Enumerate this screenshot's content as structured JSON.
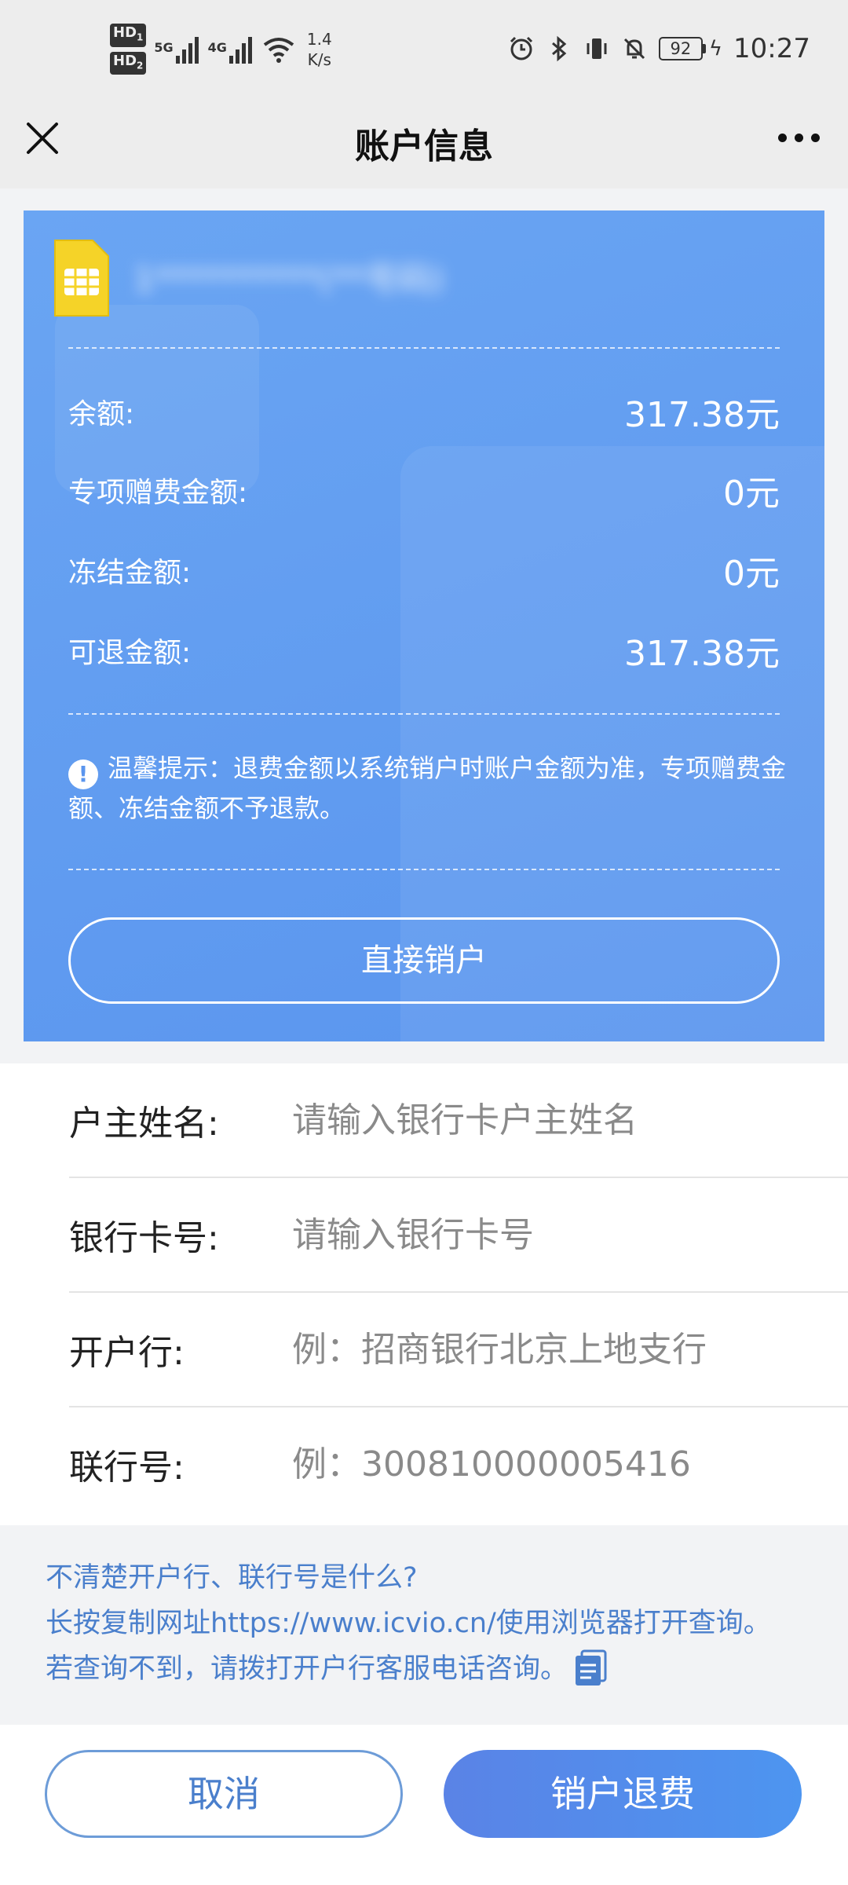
{
  "status_bar": {
    "hd1": "HD",
    "hd1_sub": "1",
    "hd2": "HD",
    "hd2_sub": "2",
    "sig1_label": "5G",
    "sig2_label": "4G",
    "net_speed_value": "1.4",
    "net_speed_unit": "K/s",
    "battery": "92",
    "time": "10:27"
  },
  "nav": {
    "title": "账户信息"
  },
  "card": {
    "masked_number": "1**********(**号码)",
    "rows": [
      {
        "label": "余额:",
        "value": "317.38元"
      },
      {
        "label": "专项赠费金额:",
        "value": "0元"
      },
      {
        "label": "冻结金额:",
        "value": "0元"
      },
      {
        "label": "可退金额:",
        "value": "317.38元"
      }
    ],
    "tip_icon": "!",
    "tip": "温馨提示：退费金额以系统销户时账户金额为准，专项赠费金额、冻结金额不予退款。",
    "close_direct_label": "直接销户"
  },
  "form": {
    "fields": [
      {
        "label": "户主姓名:",
        "placeholder": "请输入银行卡户主姓名"
      },
      {
        "label": "银行卡号:",
        "placeholder": "请输入银行卡号"
      },
      {
        "label": "开户行:",
        "placeholder": "例：招商银行北京上地支行"
      },
      {
        "label": "联行号:",
        "placeholder": "例：300810000005416"
      }
    ]
  },
  "help": {
    "line1": "不清楚开户行、联行号是什么?",
    "line2": "长按复制网址https://www.icvio.cn/使用浏览器打开查询。",
    "line3": "若查询不到，请拨打开户行客服电话咨询。"
  },
  "actions": {
    "cancel_label": "取消",
    "refund_label": "销户退费"
  },
  "colors": {
    "card_blue": "#5a95ee",
    "link_blue": "#4a7fcc",
    "sim_yellow": "#f5d328"
  }
}
